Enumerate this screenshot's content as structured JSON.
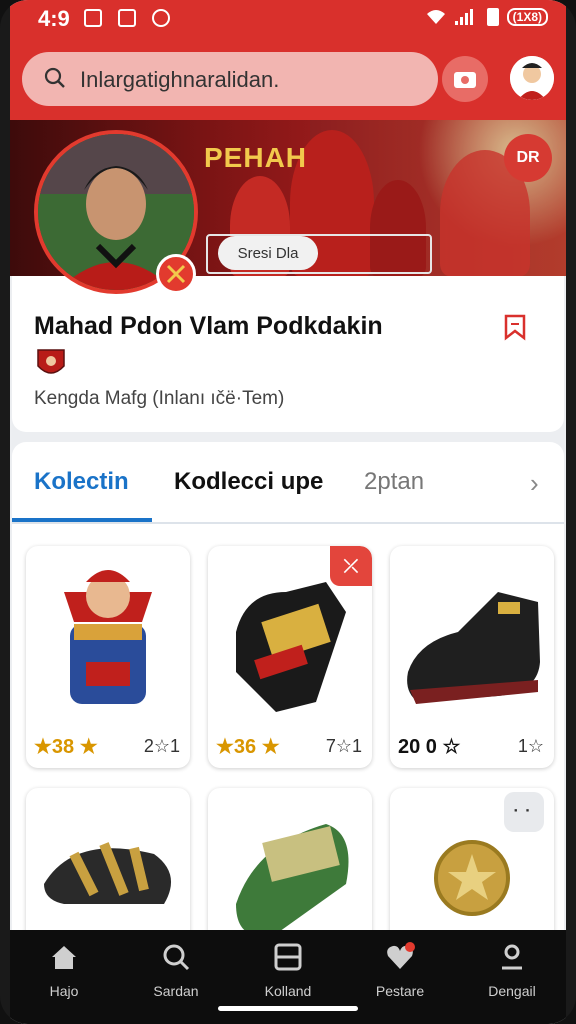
{
  "status_bar": {
    "time": "4:9",
    "battery_badge": "(1X8)"
  },
  "header": {
    "search_text": "Inlargatighnaralidan.",
    "camera_icon": "camera-icon",
    "avatar_icon": "user-avatar-icon"
  },
  "banner": {
    "title": "PEHAH",
    "chip_label": "Sresi Dla",
    "action_label": "DR"
  },
  "profile": {
    "name": "Mahad Pdon  Vlam   Podkdakin",
    "subtitle": "Kengda Mafg (Inlanı ıčë·Tem)"
  },
  "tabs": [
    {
      "label": "Kolectin",
      "active": true
    },
    {
      "label": "Kodlecci upe",
      "active": false
    },
    {
      "label": "2ptan",
      "active": false
    }
  ],
  "items": [
    {
      "rating": "★38 ★",
      "count": "2☆1",
      "icon": "figure-collectible-icon"
    },
    {
      "rating": "★36 ★",
      "count": "7☆1",
      "icon": "glove-icon",
      "tag": "⤫"
    },
    {
      "rating": "20 0 ☆",
      "count": "1☆",
      "icon": "sneaker-icon"
    },
    {
      "rating": "",
      "count": "",
      "icon": "sandal-icon"
    },
    {
      "rating": "",
      "count": "",
      "icon": "slide-sandal-icon"
    },
    {
      "rating": "",
      "count": "",
      "icon": "coin-icon",
      "more": "⠂⠂"
    }
  ],
  "nav": [
    {
      "label": "Hajo",
      "icon": "home-icon"
    },
    {
      "label": "Sardan",
      "icon": "search-icon"
    },
    {
      "label": "Kolland",
      "icon": "collection-icon"
    },
    {
      "label": "Pestare",
      "icon": "heart-icon"
    },
    {
      "label": "Dengail",
      "icon": "profile-icon"
    }
  ],
  "colors": {
    "brand_red": "#d9302c",
    "accent_blue": "#1a73c8",
    "star_gold": "#d99600"
  }
}
